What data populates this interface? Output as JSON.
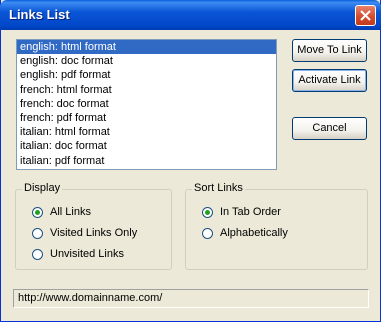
{
  "window": {
    "title": "Links List"
  },
  "links": {
    "items": [
      "english: html format",
      "english: doc format",
      "english: pdf format",
      "french: html format",
      "french: doc format",
      "french: pdf format",
      "italian: html format",
      "italian: doc format",
      "italian: pdf format"
    ],
    "selected": "english: html format"
  },
  "buttons": {
    "move_to_link": "Move To Link",
    "activate_link": "Activate Link",
    "cancel": "Cancel"
  },
  "display": {
    "label": "Display",
    "options": [
      "All Links",
      "Visited Links Only",
      "Unvisited Links"
    ],
    "selected": "All Links"
  },
  "sort": {
    "label": "Sort Links",
    "options": [
      "In Tab Order",
      "Alphabetically"
    ],
    "selected": "In Tab Order"
  },
  "status": {
    "url": "http://www.domainname.com/"
  },
  "colors": {
    "selection": "#316ac5",
    "titlebar": "#0054e3",
    "close": "#d14a2c"
  }
}
